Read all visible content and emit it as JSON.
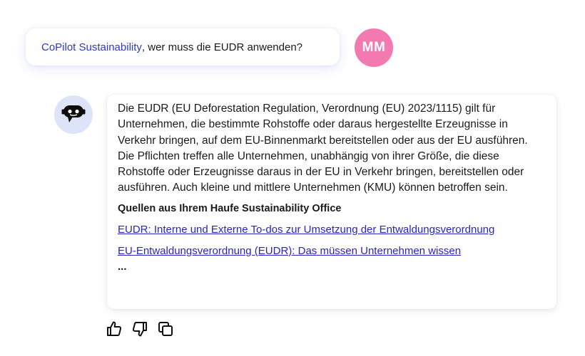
{
  "user_message": {
    "mention": "CoPilot Sustainability",
    "text": ", wer muss die EUDR anwenden?",
    "avatar_initials": "MM",
    "avatar_color": "#f27ab1"
  },
  "bot": {
    "avatar_icon": "robot-icon",
    "avatar_bg": "#dde4f8",
    "paragraph_1": "Die EUDR (EU Deforestation Regulation, Verordnung (EU) 2023/1115) gilt für Unternehmen, die bestimmte Rohstoffe oder daraus hergestellte Erzeugnisse in Verkehr bringen, auf dem EU-Binnenmarkt bereitstellen oder aus der EU ausführen.",
    "paragraph_2": "Die Pflichten treffen alle Unternehmen, unabhängig von ihrer Größe, die diese Rohstoffe oder Erzeugnisse daraus in der EU in Verkehr bringen, bereitstellen oder ausführen. Auch kleine und mittlere Unternehmen (KMU) können betroffen sein.",
    "sources_heading": "Quellen aus Ihrem Haufe Sustainability Office",
    "sources": [
      "EUDR: Interne und Externe To-dos zur Umsetzung der Entwaldungsverordnung",
      "EU-Entwaldungsverordnung (EUDR): Das müssen Unternehmen wissen"
    ],
    "more": "..."
  },
  "actions": [
    {
      "icon": "thumbs-up-icon"
    },
    {
      "icon": "thumbs-down-icon"
    },
    {
      "icon": "copy-icon"
    }
  ],
  "colors": {
    "mention": "#2c3ac4",
    "link": "#2525c9"
  }
}
